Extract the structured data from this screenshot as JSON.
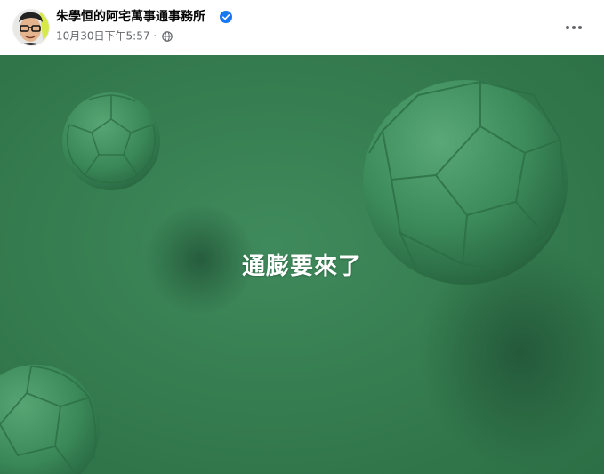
{
  "post": {
    "author": {
      "name": "朱學恒的阿宅萬事通事務所",
      "verified": true,
      "verified_icon": "verified-badge-icon",
      "avatar_icon": "profile-avatar"
    },
    "timestamp": "10月30日下午5:57",
    "separator": "·",
    "audience_icon": "globe-icon",
    "more_icon": "more-options-icon",
    "media": {
      "overlay_text": "通膨要來了",
      "background_color": "#367e51",
      "ball_color": "#3e8d5e"
    }
  },
  "colors": {
    "name_text": "#050505",
    "meta_text": "#65676b",
    "verified_blue": "#1877f2"
  }
}
